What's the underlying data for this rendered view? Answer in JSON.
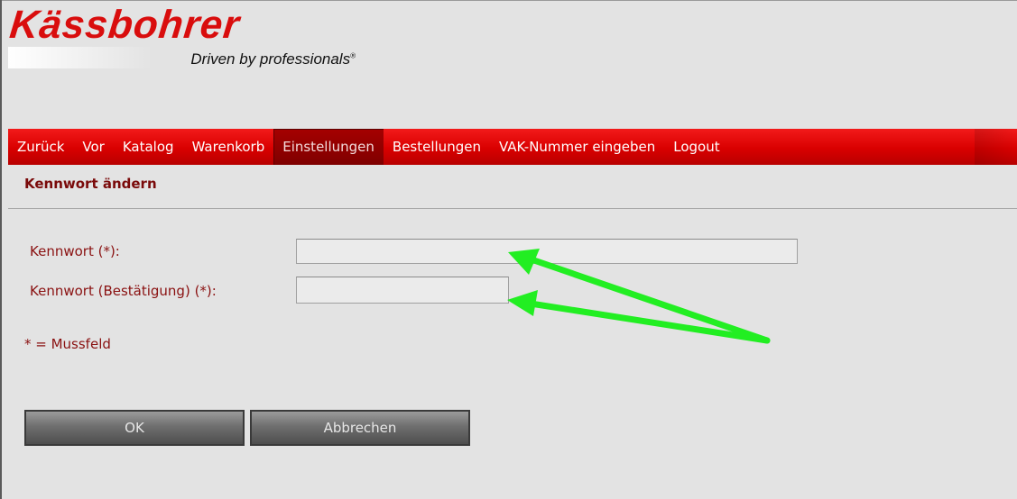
{
  "brand": {
    "name": "Kässbohrer",
    "tagline": "Driven by professionals",
    "trademark": "®",
    "brand_color": "#d90d0d"
  },
  "nav": {
    "items": [
      {
        "label": "Zurück"
      },
      {
        "label": "Vor"
      },
      {
        "label": "Katalog"
      },
      {
        "label": "Warenkorb"
      },
      {
        "label": "Einstellungen",
        "active": true
      },
      {
        "label": "Bestellungen"
      },
      {
        "label": "VAK-Nummer eingeben"
      },
      {
        "label": "Logout"
      }
    ]
  },
  "page": {
    "title": "Kennwort ändern"
  },
  "form": {
    "password_label": "Kennwort (*):",
    "password_value": "",
    "confirm_label": "Kennwort (Bestätigung) (*):",
    "confirm_value": "",
    "mandatory_note": "* = Mussfeld"
  },
  "buttons": {
    "ok": "OK",
    "cancel": "Abbrechen"
  },
  "colors": {
    "annotation_arrow": "#22ee22",
    "label_text": "#8a1111",
    "nav_background": "#d90000"
  }
}
